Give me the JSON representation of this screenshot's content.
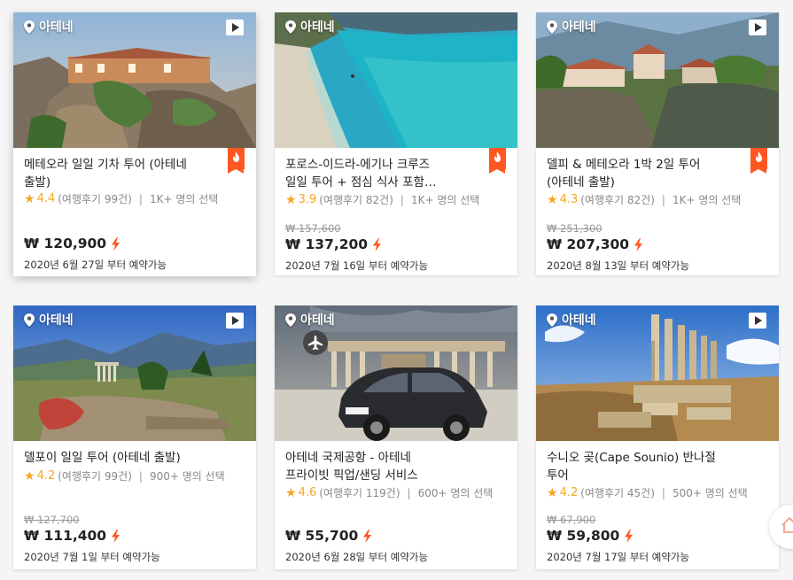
{
  "colors": {
    "accent": "#ff5722",
    "star": "#f5a623",
    "text": "#222222",
    "muted": "#888888"
  },
  "icons": {
    "location": "pin-icon",
    "video": "play-icon",
    "hot": "flame-icon",
    "instant": "bolt-icon",
    "airport": "plane-icon",
    "home": "home-icon"
  },
  "cards": [
    {
      "location": "아테네",
      "title": "메테오라 일일 기차 투어 (아테네\n출발)",
      "rating": "4.4",
      "reviews": "(여행후기 99건)",
      "chosen": "1K+ 명의 선택",
      "old_price": "",
      "price": "₩ 120,900",
      "available": "2020년 6월 27일 부터 예약가능"
    },
    {
      "location": "아테네",
      "title": "포로스-이드라-에기나 크루즈\n일일 투어 + 점심 식사 포함…",
      "rating": "3.9",
      "reviews": "(여행후기 82건)",
      "chosen": "1K+ 명의 선택",
      "old_price": "₩ 157,600",
      "price": "₩ 137,200",
      "available": "2020년 7월 16일 부터 예약가능"
    },
    {
      "location": "아테네",
      "title": "델피 & 메테오라 1박 2일 투어\n(아테네 출발)",
      "rating": "4.3",
      "reviews": "(여행후기 82건)",
      "chosen": "1K+ 명의 선택",
      "old_price": "₩ 251,300",
      "price": "₩ 207,300",
      "available": "2020년 8월 13일 부터 예약가능"
    },
    {
      "location": "아테네",
      "title": "델포이 일일 투어 (아테네 출발)",
      "rating": "4.2",
      "reviews": "(여행후기 99건)",
      "chosen": "900+ 명의 선택",
      "old_price": "₩ 127,700",
      "price": "₩ 111,400",
      "available": "2020년 7월 1일 부터 예약가능"
    },
    {
      "location": "아테네",
      "title": "아테네 국제공항 - 아테네\n프라이빗 픽업/샌딩 서비스",
      "rating": "4.6",
      "reviews": "(여행후기 119건)",
      "chosen": "600+ 명의 선택",
      "old_price": "",
      "price": "₩ 55,700",
      "available": "2020년 6월 28일 부터 예약가능"
    },
    {
      "location": "아테네",
      "title": "수니오 곶(Cape Sounio) 반나절\n투어",
      "rating": "4.2",
      "reviews": "(여행후기 45건)",
      "chosen": "500+ 명의 선택",
      "old_price": "₩ 67,900",
      "price": "₩ 59,800",
      "available": "2020년 7월 17일 부터 예약가능"
    }
  ]
}
